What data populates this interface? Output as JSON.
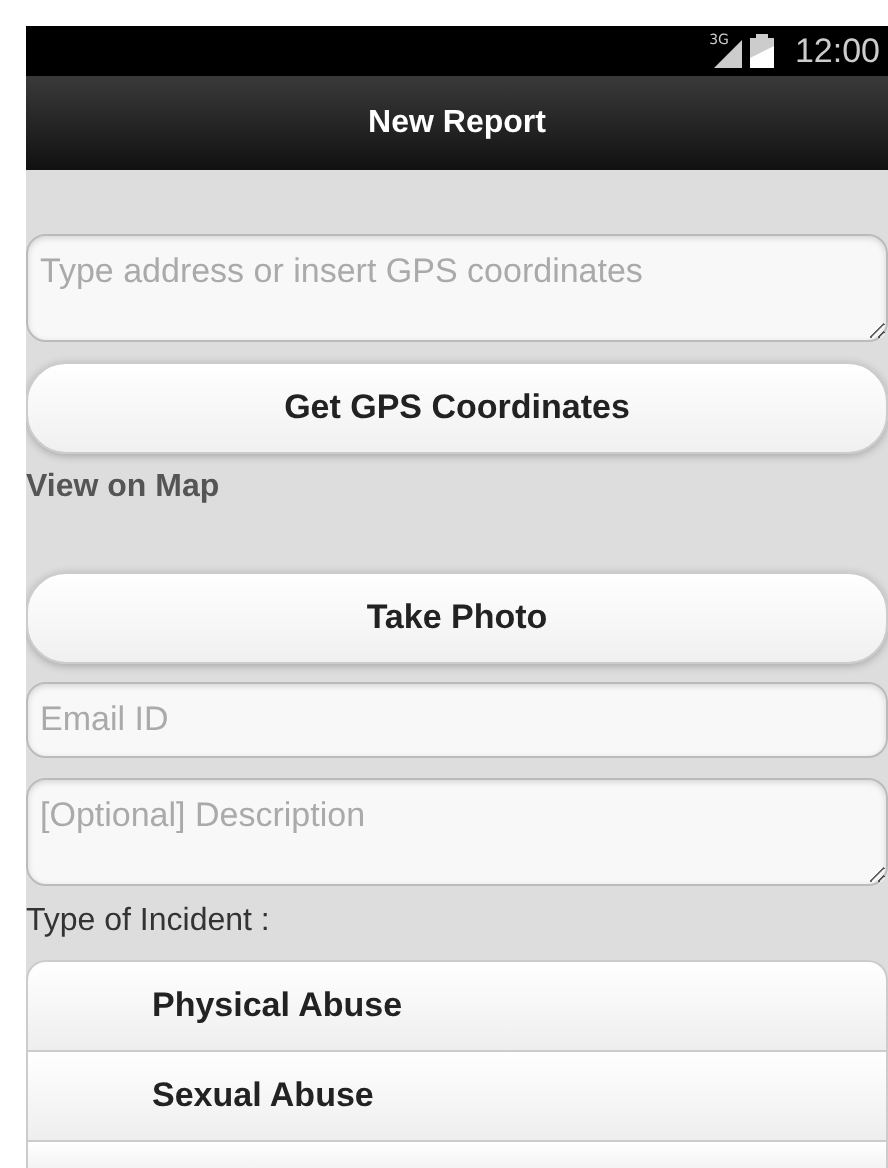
{
  "status_bar": {
    "network": "3G",
    "time": "12:00"
  },
  "header": {
    "title": "New Report"
  },
  "location": {
    "placeholder": "Type address or insert GPS coordinates"
  },
  "gps_button": {
    "label": "Get GPS Coordinates"
  },
  "map_link": {
    "label": "View on Map"
  },
  "photo_button": {
    "label": "Take Photo"
  },
  "email": {
    "placeholder": "Email ID"
  },
  "description": {
    "placeholder": "[Optional] Description"
  },
  "incident": {
    "label": "Type of Incident :",
    "options": [
      {
        "label": "Physical Abuse"
      },
      {
        "label": "Sexual Abuse"
      }
    ]
  }
}
